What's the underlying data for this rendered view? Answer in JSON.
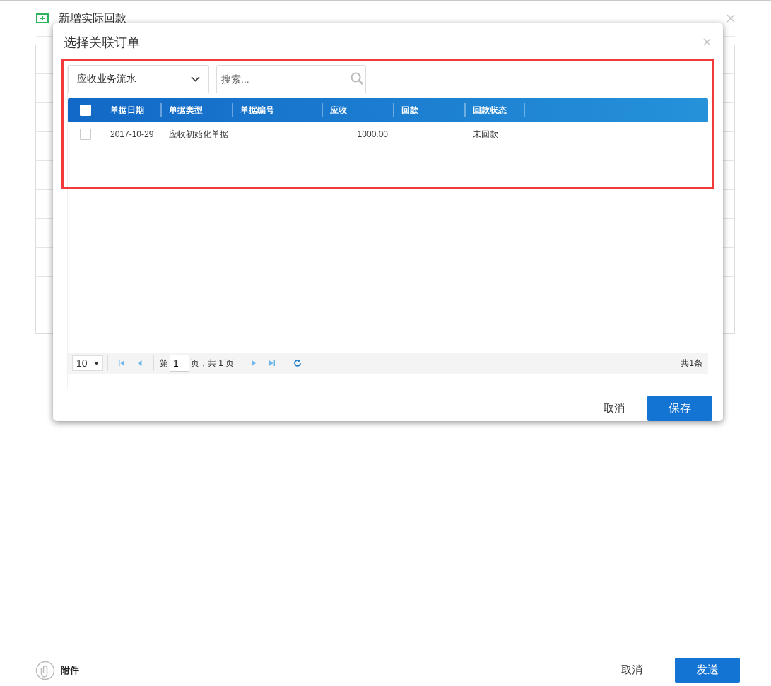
{
  "background_dialog": {
    "title": "新增实际回款",
    "footer": {
      "attachment_label": "附件",
      "cancel": "取消",
      "send": "发送"
    }
  },
  "modal": {
    "title": "选择关联订单",
    "highlighted": true,
    "filter": {
      "value": "应收业务流水"
    },
    "search": {
      "placeholder": "搜索..."
    },
    "table": {
      "all_checked": false,
      "columns": [
        {
          "label": "单据日期"
        },
        {
          "label": "单据类型"
        },
        {
          "label": "单据编号"
        },
        {
          "label": "应收"
        },
        {
          "label": "回款"
        },
        {
          "label": "回款状态"
        }
      ],
      "rows": [
        {
          "checked": false,
          "doc_date": "2017-10-29",
          "doc_type": "应收初始化单据",
          "receivable": "1000.00",
          "repayment_status": "未回款"
        }
      ]
    },
    "pager": {
      "page_size": "10",
      "page_prefix": "第",
      "page": "1",
      "page_suffix": "页，共 1 页",
      "total": "共1条"
    },
    "buttons": {
      "cancel": "取消",
      "save": "保存"
    }
  }
}
